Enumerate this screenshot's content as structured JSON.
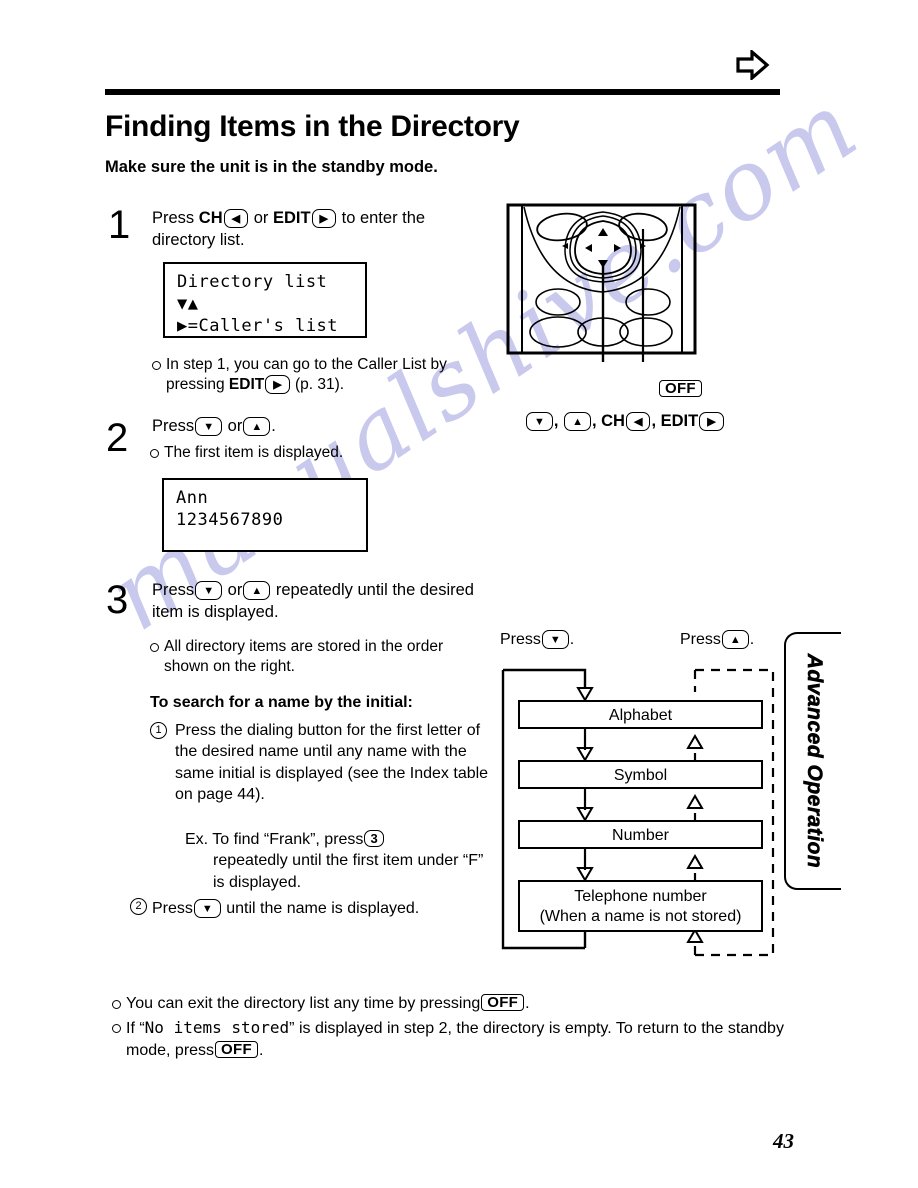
{
  "page": {
    "number": "43",
    "top_arrow_icon": "right-arrow-icon",
    "watermark": "manualshive.com",
    "watermark_color": "#c9c9ee"
  },
  "heading": {
    "title": "Finding Items in the Directory",
    "subtitle": "Make sure the unit is in the standby mode."
  },
  "side_tab": {
    "label": "Advanced Operation"
  },
  "steps": [
    {
      "number": "1",
      "instruction_a": "Press",
      "key_ch_label": "CH",
      "key_ch_glyph": "◀",
      "instruction_b": "or",
      "key_edit_label": "EDIT",
      "key_edit_glyph": "▶",
      "instruction_c": "to enter the directory list.",
      "lcd": {
        "line1": "Directory list",
        "line2": "▼▲",
        "line3": "▶=Caller's list"
      },
      "note_a": "In step 1, you can go to the Caller List by pressing",
      "note_key_label": "EDIT",
      "note_key_glyph": "▶",
      "note_b": "(p. 31)."
    },
    {
      "number": "2",
      "instruction_a": "Press",
      "key_down_glyph": "▼",
      "instruction_b": "or",
      "key_up_glyph": "▲",
      "instruction_c": ".",
      "note": "The first item is displayed.",
      "lcd": {
        "line1": "Ann",
        "line2": "1234567890"
      }
    },
    {
      "number": "3",
      "instruction_a": "Press",
      "key_down_glyph": "▼",
      "instruction_b": "or",
      "key_up_glyph": "▲",
      "instruction_c": "repeatedly until the desired item is displayed.",
      "note": "All directory items are stored in the order shown on the right.",
      "search_heading": "To search for a name by the initial:",
      "item1_num": "1",
      "item1_text": "Press the dialing button for the first letter of the desired name until any name with the same initial is displayed (see the Index table on page 44).",
      "example_prefix": "Ex. To find “Frank”, press",
      "example_key": "3",
      "example_suffix": "repeatedly until the first item under “F” is displayed.",
      "item2_num": "2",
      "item2_text_a": "Press",
      "item2_key_glyph": "▼",
      "item2_text_b": "until the name is displayed."
    }
  ],
  "device_diagram": {
    "off_key_label": "OFF",
    "keys_caption_down": "▼",
    "keys_caption_up": "▲",
    "keys_caption_ch": "CH",
    "keys_caption_ch_glyph": "◀",
    "keys_caption_edit": "EDIT",
    "keys_caption_edit_glyph": "▶",
    "caption_sep": ", "
  },
  "flow_chart": {
    "press_down_label": "Press",
    "press_down_glyph": "▼",
    "press_down_suffix": ".",
    "press_up_label": "Press",
    "press_up_glyph": "▲",
    "press_up_suffix": ".",
    "boxes": [
      {
        "label": "Alphabet"
      },
      {
        "label": "Symbol"
      },
      {
        "label": "Number"
      },
      {
        "label": "Telephone number",
        "sublabel": "(When a name is not stored)"
      }
    ]
  },
  "footer_notes": {
    "note1_a": "You can exit the directory list any time by pressing",
    "note1_key": "OFF",
    "note1_b": ".",
    "note2_a": "If “",
    "note2_mono": "No items stored",
    "note2_b": "” is displayed in step 2, the directory is empty. To return to the standby mode, press",
    "note2_key": "OFF",
    "note2_c": "."
  }
}
